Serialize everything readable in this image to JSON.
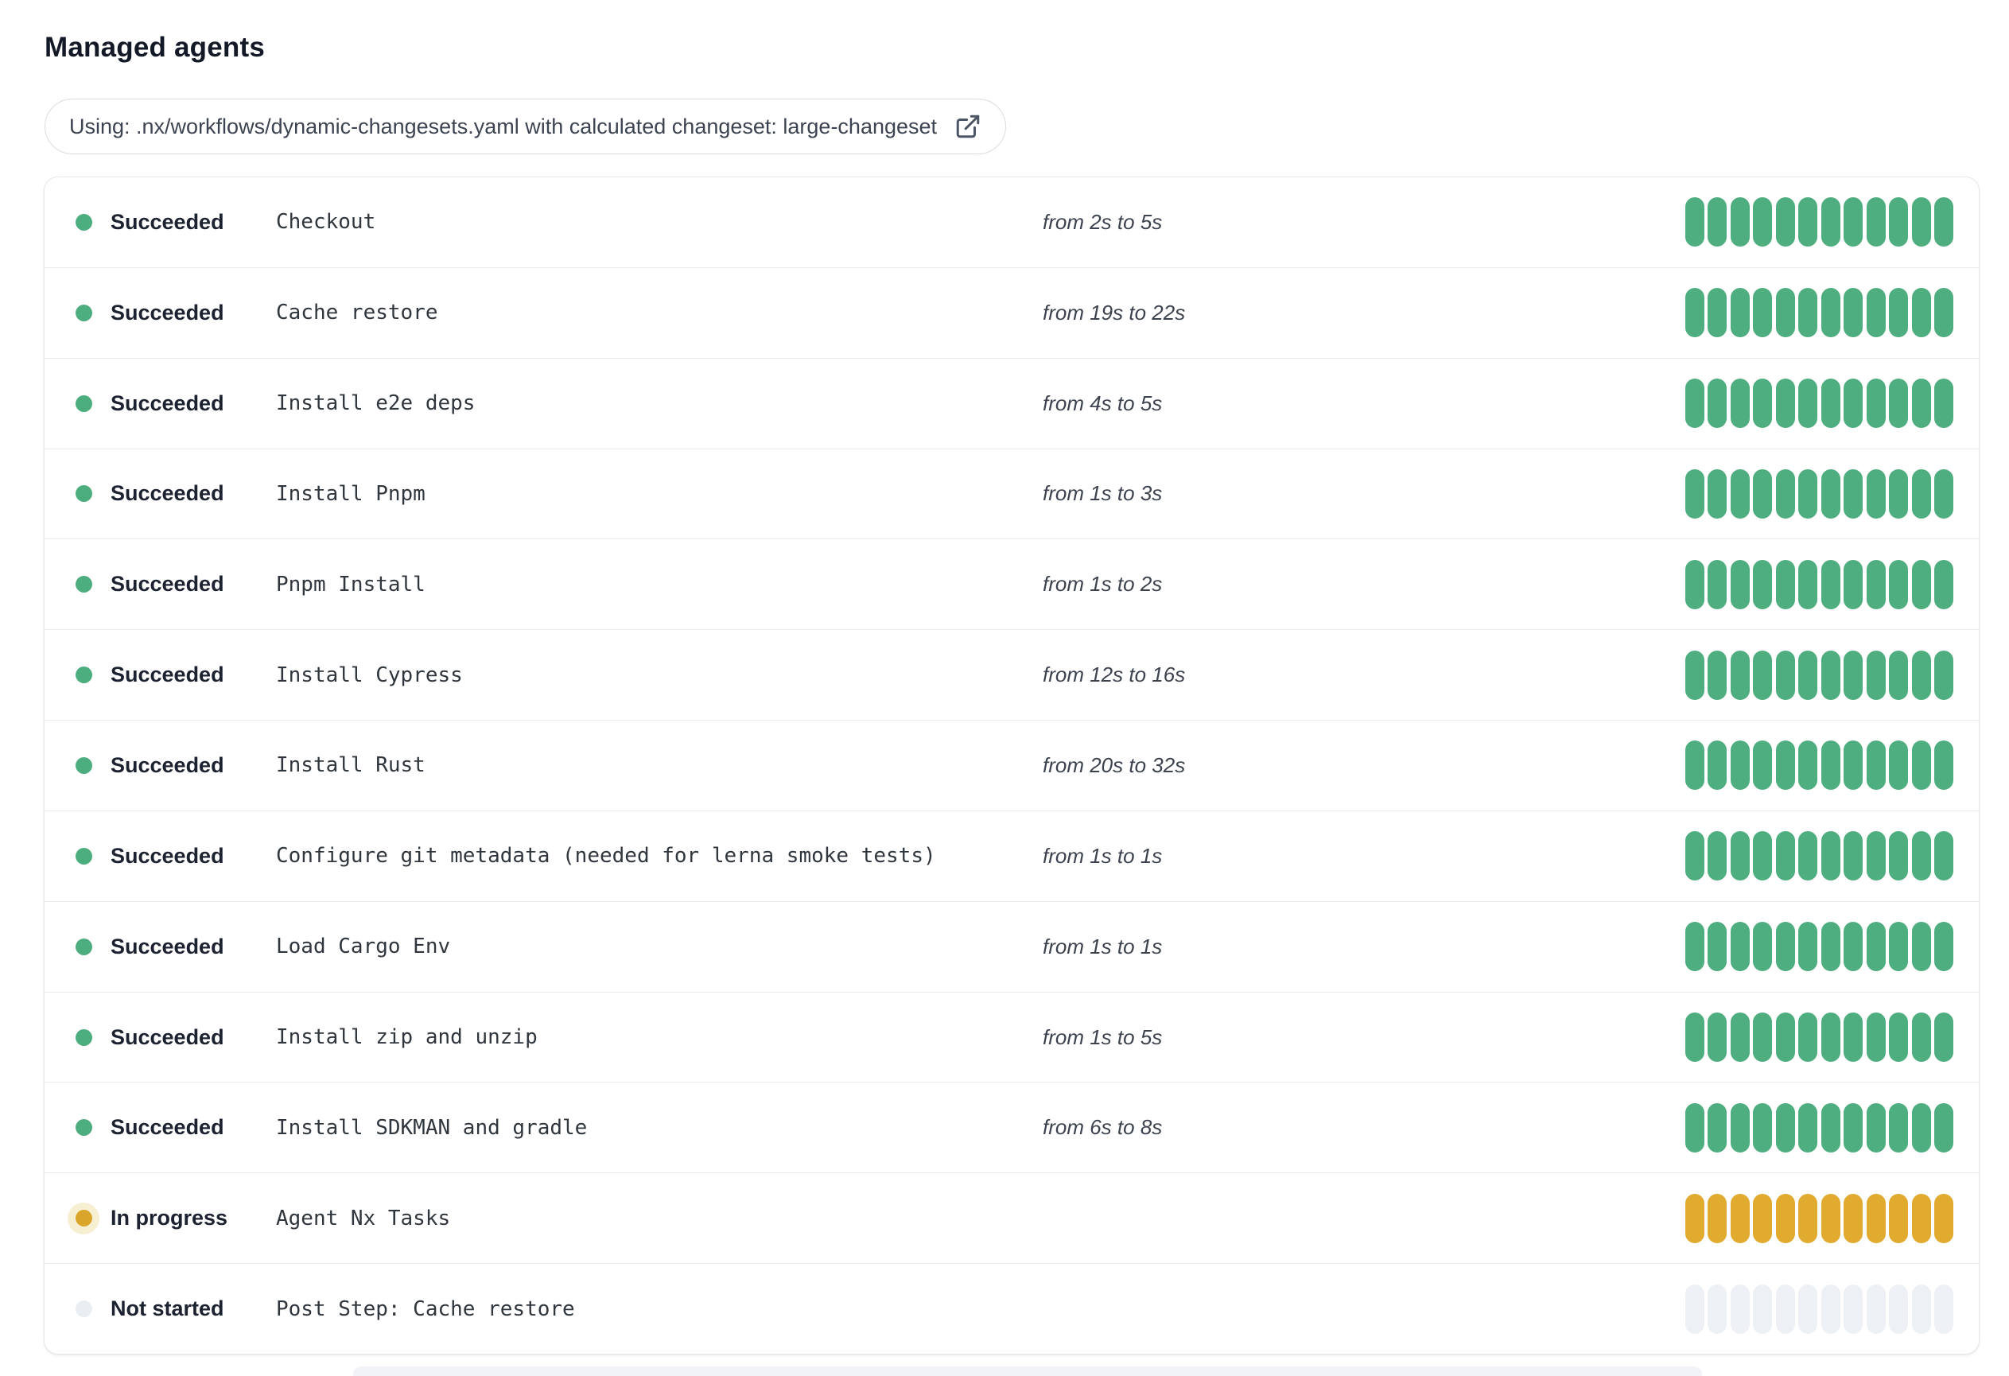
{
  "page": {
    "title": "Managed agents"
  },
  "workflow_badge": {
    "label": "Using: .nx/workflows/dynamic-changesets.yaml with calculated changeset: large-changeset",
    "icon": "external-link-icon"
  },
  "bars": {
    "segments_per_row": 12
  },
  "colors": {
    "succeeded": "#4fae80",
    "in_progress": "#e0ab2f",
    "not_started": "#edf1f5",
    "in_progress_dot": "#d9a62b",
    "in_progress_halo": "#f7efd2"
  },
  "rows": [
    {
      "status": "Succeeded",
      "state": "succeeded",
      "name": "Checkout",
      "time": "from 2s to 5s"
    },
    {
      "status": "Succeeded",
      "state": "succeeded",
      "name": "Cache restore",
      "time": "from 19s to 22s"
    },
    {
      "status": "Succeeded",
      "state": "succeeded",
      "name": "Install e2e deps",
      "time": "from 4s to 5s"
    },
    {
      "status": "Succeeded",
      "state": "succeeded",
      "name": "Install Pnpm",
      "time": "from 1s to 3s"
    },
    {
      "status": "Succeeded",
      "state": "succeeded",
      "name": "Pnpm Install",
      "time": "from 1s to 2s"
    },
    {
      "status": "Succeeded",
      "state": "succeeded",
      "name": "Install Cypress",
      "time": "from 12s to 16s"
    },
    {
      "status": "Succeeded",
      "state": "succeeded",
      "name": "Install Rust",
      "time": "from 20s to 32s"
    },
    {
      "status": "Succeeded",
      "state": "succeeded",
      "name": "Configure git metadata (needed for lerna smoke tests)",
      "time": "from 1s to 1s"
    },
    {
      "status": "Succeeded",
      "state": "succeeded",
      "name": "Load Cargo Env",
      "time": "from 1s to 1s"
    },
    {
      "status": "Succeeded",
      "state": "succeeded",
      "name": "Install zip and unzip",
      "time": "from 1s to 5s"
    },
    {
      "status": "Succeeded",
      "state": "succeeded",
      "name": "Install SDKMAN and gradle",
      "time": "from 6s to 8s"
    },
    {
      "status": "In progress",
      "state": "in-progress",
      "name": "Agent Nx Tasks",
      "time": ""
    },
    {
      "status": "Not started",
      "state": "not-started",
      "name": "Post Step: Cache restore",
      "time": ""
    }
  ]
}
